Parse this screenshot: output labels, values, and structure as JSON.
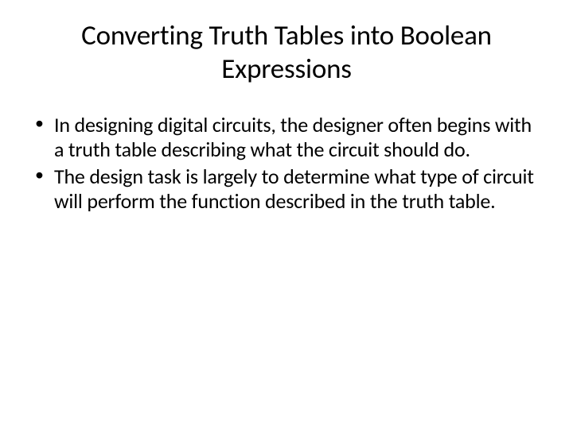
{
  "slide": {
    "title": "Converting Truth Tables into Boolean Expressions",
    "bullets": [
      "In designing digital circuits, the designer often begins with a truth table describing what the circuit should do.",
      "The design task is largely to determine what type of circuit will perform the function described in the truth table."
    ]
  }
}
